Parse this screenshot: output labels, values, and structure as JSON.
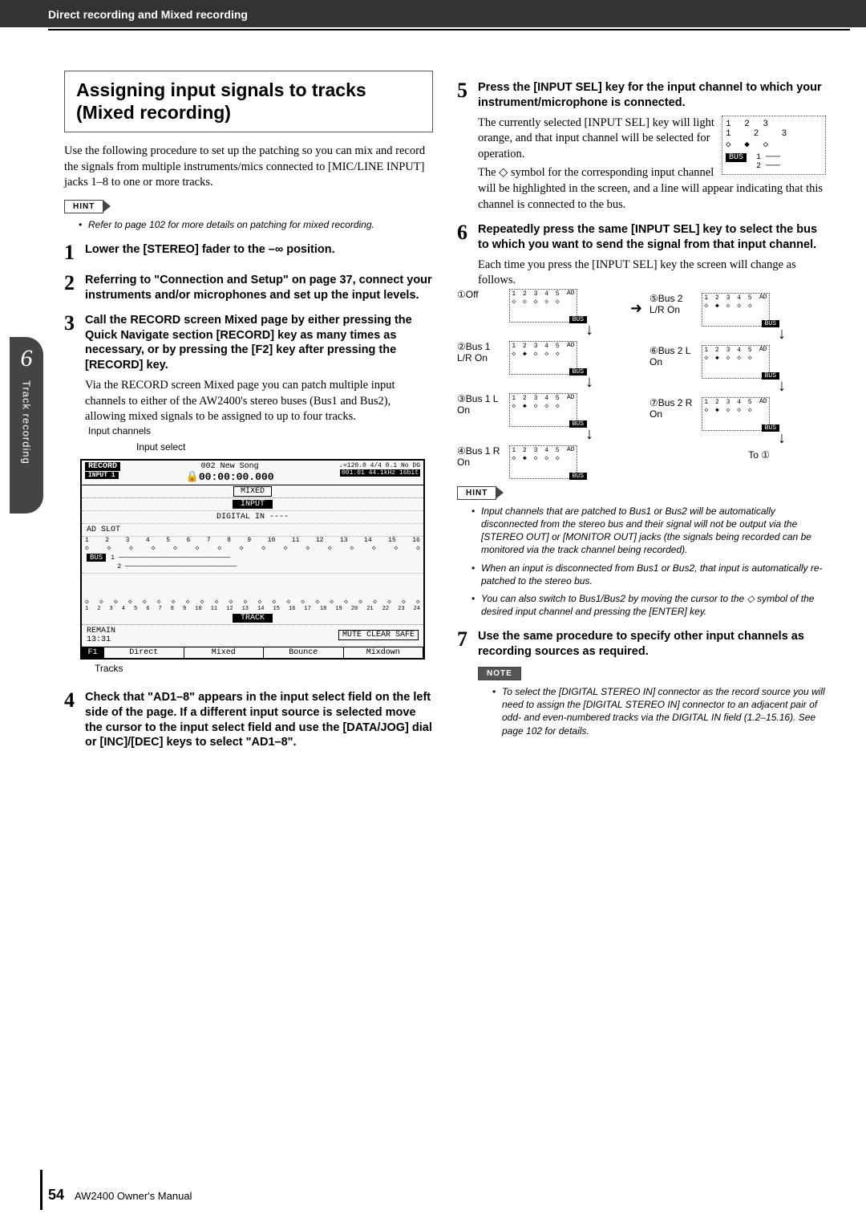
{
  "header": {
    "title": "Direct recording and Mixed recording"
  },
  "sidebar": {
    "chapter": "6",
    "label": "Track recording"
  },
  "section": {
    "title": "Assigning input signals to tracks (Mixed recording)"
  },
  "intro": "Use the following procedure to set up the patching so you can mix and record the signals from multiple instruments/mics connected to [MIC/LINE INPUT] jacks 1–8 to one or more tracks.",
  "hint1": {
    "label": "HINT",
    "bullets": [
      "Refer to page 102 for more details on patching for mixed recording."
    ]
  },
  "steps_left": [
    {
      "num": "1",
      "head": "Lower the [STEREO] fader to the –∞ position."
    },
    {
      "num": "2",
      "head": "Referring to \"Connection and Setup\" on page 37, connect your instruments and/or microphones and set up the input levels."
    },
    {
      "num": "3",
      "head": "Call the RECORD screen Mixed page by either pressing the Quick Navigate section [RECORD] key as many times as necessary, or by pressing the [F2] key after pressing the [RECORD] key.",
      "body": "Via the RECORD screen Mixed page you can patch multiple input channels to either of the AW2400's stereo buses (Bus1 and Bus2), allowing mixed signals to be assigned to up to four tracks."
    },
    {
      "num": "4",
      "head": "Check that \"AD1–8\" appears in the input select field on the left side of the page. If a different input source is selected move the cursor to the input select field and use the [DATA/JOG] dial or [INC]/[DEC] keys to select \"AD1–8\"."
    }
  ],
  "lcd": {
    "annot_top1": "Input channels",
    "annot_top2": "Input select",
    "title_l": "RECORD",
    "title_sub": "INPUT 1",
    "song": "002 New Song",
    "time": "🔒00:00:00.000",
    "tempo": "♩=120.0   4/4   0.1   No DG",
    "meter": "001.01 44.1kHz  16bit",
    "mode": "MIXED",
    "row_input": "INPUT",
    "row_dig": "DIGITAL IN   ----",
    "row_ad": "AD                SLOT",
    "bus": "BUS",
    "track_lbl": "TRACK",
    "remain": "REMAIN\n13:31",
    "btns": "MUTE CLEAR   SAFE",
    "tabs": [
      "Direct",
      "Mixed",
      "Bounce",
      "Mixdown"
    ],
    "tab_icon": "F1",
    "annot_bottom": "Tracks"
  },
  "steps_right": [
    {
      "num": "5",
      "head": "Press the [INPUT SEL] key for the input channel to which your instrument/microphone is connected.",
      "body1": "The currently selected [INPUT SEL] key will light orange, and that input channel will be selected for operation.",
      "body2": "The ◇ symbol for the corresponding input channel will be highlighted in the screen, and a line will appear indicating that this channel is connected to the bus."
    },
    {
      "num": "6",
      "head": "Repeatedly press the same [INPUT SEL] key to select the bus to which you want to send the signal from that input channel.",
      "body": "Each time you press the [INPUT SEL] key the screen will change as follows."
    },
    {
      "num": "7",
      "head": "Use the same procedure to specify other input channels as recording sources as required."
    }
  ],
  "corner": {
    "nums": "1  2  3",
    "marks": "◇  ◆  ◇",
    "bus": "BUS"
  },
  "bus_states": [
    {
      "n": "①",
      "label": "Off"
    },
    {
      "n": "②",
      "label": "Bus 1 L/R On"
    },
    {
      "n": "③",
      "label": "Bus 1 L On"
    },
    {
      "n": "④",
      "label": "Bus 1 R On"
    },
    {
      "n": "⑤",
      "label": "Bus 2 L/R On"
    },
    {
      "n": "⑥",
      "label": "Bus 2 L On"
    },
    {
      "n": "⑦",
      "label": "Bus 2 R On"
    }
  ],
  "to_one": "To ①",
  "bus_diag": {
    "ad": "AD",
    "nums": "1 2 3 4 5",
    "dots": "◇ ◇ ◇ ◇ ◇",
    "bus": "BUS"
  },
  "hint2": {
    "label": "HINT",
    "bullets": [
      "Input channels that are patched to Bus1 or Bus2 will be automatically disconnected from the stereo bus and their signal will not be output via the [STEREO OUT] or [MONITOR OUT] jacks (the signals being recorded can be monitored via the track channel being recorded).",
      "When an input is disconnected from Bus1 or Bus2, that input is automatically re-patched to the stereo bus.",
      "You can also switch to Bus1/Bus2 by moving the cursor to the ◇ symbol of the desired input channel and pressing the [ENTER] key."
    ]
  },
  "note": {
    "label": "NOTE",
    "bullets": [
      "To select the [DIGITAL STEREO IN] connector as the record source you will need to assign the [DIGITAL STEREO IN] connector to an adjacent pair of odd- and even-numbered tracks via the DIGITAL IN field (1.2–15.16). See page 102 for details."
    ]
  },
  "footer": {
    "page": "54",
    "manual": "AW2400  Owner's Manual"
  }
}
